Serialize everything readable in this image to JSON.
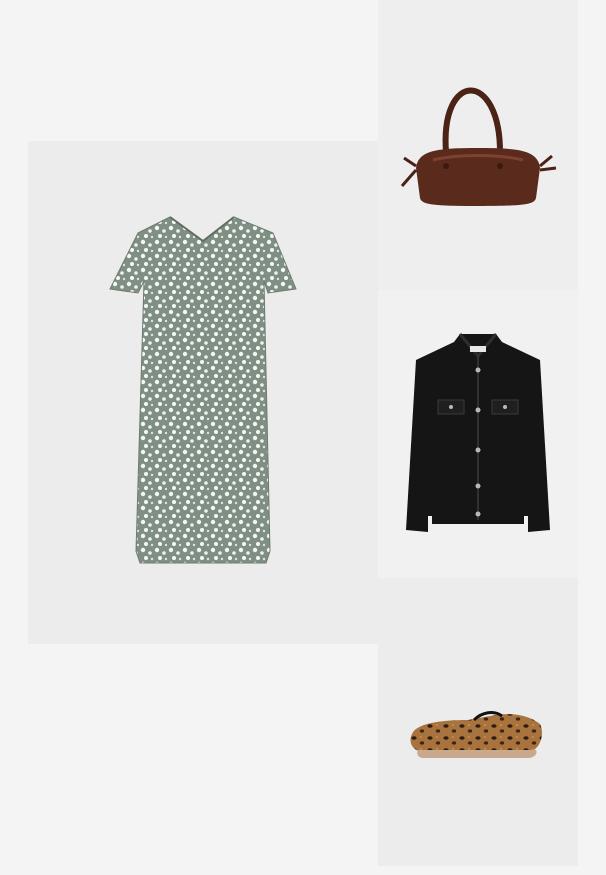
{
  "outfit": {
    "items": [
      {
        "id": "dress",
        "icon": "floral-dress-image",
        "colors": {
          "base": "#9aa79c",
          "flowers": "#f4f6f2"
        }
      },
      {
        "id": "bag",
        "icon": "brown-leather-bag-image",
        "colors": {
          "body": "#5a2a1c",
          "shine": "#8a4d37"
        }
      },
      {
        "id": "jacket",
        "icon": "black-denim-jacket-image",
        "colors": {
          "body": "#151515",
          "buttons": "#b9b9b9"
        }
      },
      {
        "id": "shoes",
        "icon": "leopard-flat-shoes-image",
        "colors": {
          "body": "#a8733d",
          "spots": "#2e1e12",
          "sole": "#c9a98e"
        }
      }
    ]
  }
}
